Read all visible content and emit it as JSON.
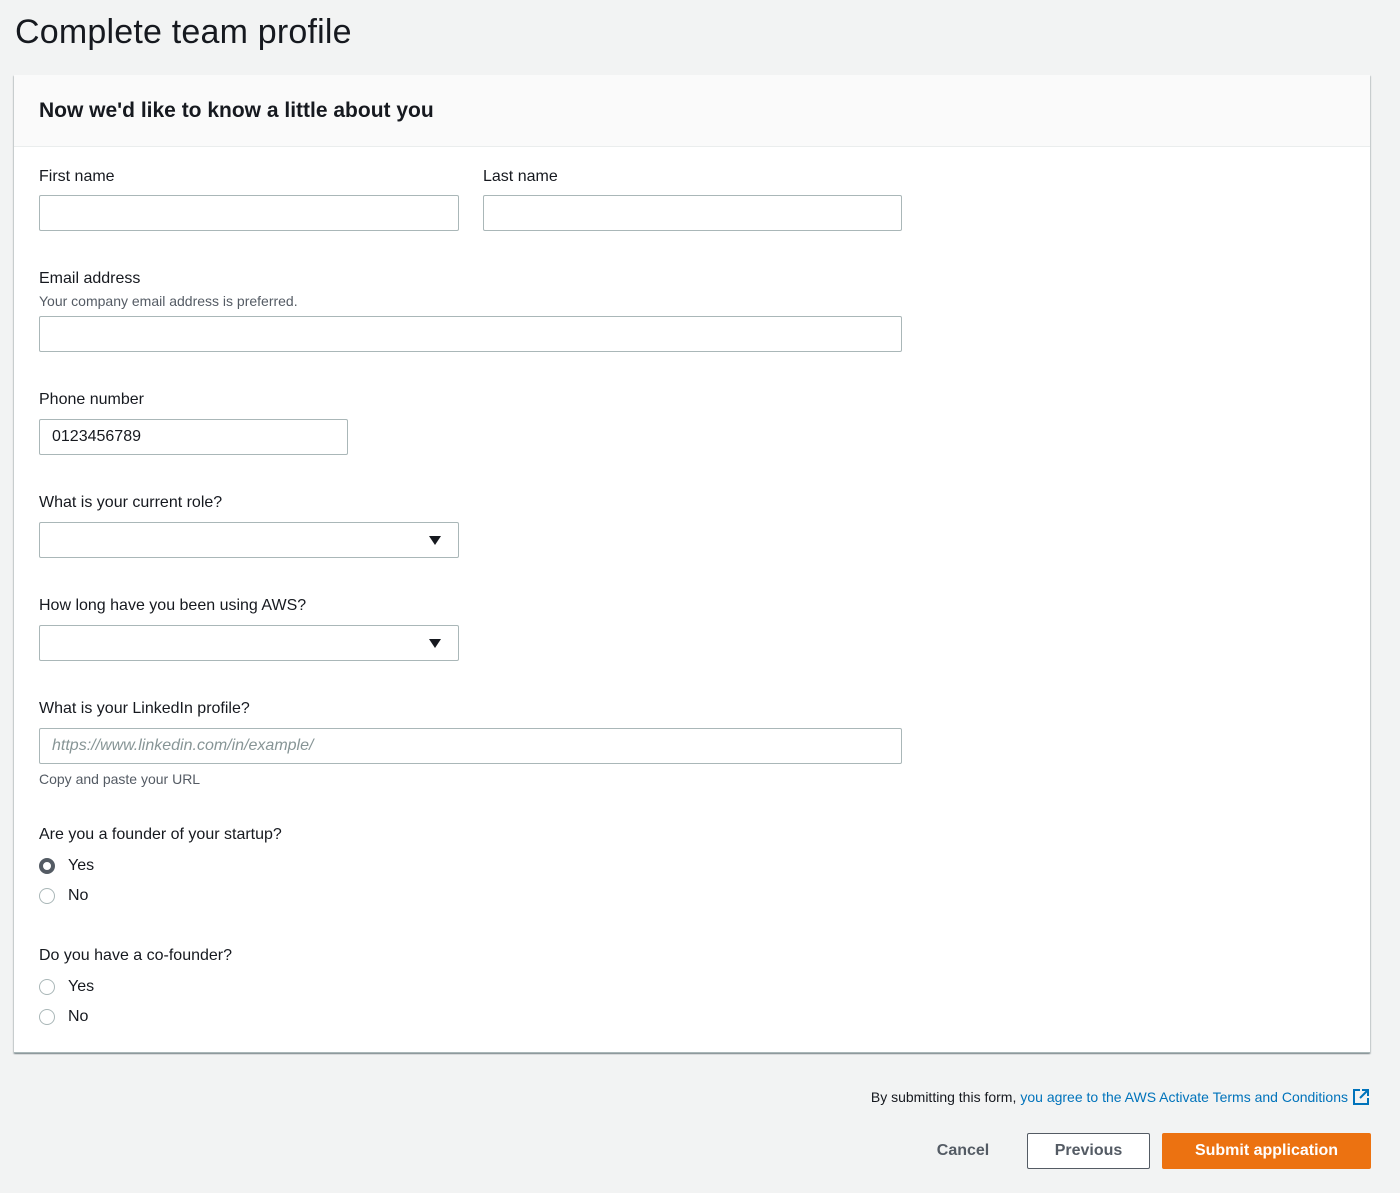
{
  "page": {
    "title": "Complete team profile"
  },
  "panel": {
    "heading": "Now we'd like to know a little about you"
  },
  "fields": {
    "first_name": {
      "label": "First name",
      "value": ""
    },
    "last_name": {
      "label": "Last name",
      "value": ""
    },
    "email": {
      "label": "Email address",
      "description": "Your company email address is preferred.",
      "value": ""
    },
    "phone": {
      "label": "Phone number",
      "value": "0123456789"
    },
    "role": {
      "label": "What is your current role?",
      "selected": ""
    },
    "aws_duration": {
      "label": "How long have you been using AWS?",
      "selected": ""
    },
    "linkedin": {
      "label": "What is your LinkedIn profile?",
      "placeholder": "https://www.linkedin.com/in/example/",
      "hint": "Copy and paste your URL",
      "value": ""
    },
    "founder": {
      "label": "Are you a founder of your startup?",
      "options": [
        "Yes",
        "No"
      ],
      "selected": "Yes"
    },
    "cofounder": {
      "label": "Do you have a co-founder?",
      "options": [
        "Yes",
        "No"
      ],
      "selected": ""
    }
  },
  "footer": {
    "terms_prefix": "By submitting this form,",
    "terms_link": "you agree to the AWS Activate Terms and Conditions",
    "external_icon": "external-link-icon",
    "cancel_label": "Cancel",
    "previous_label": "Previous",
    "submit_label": "Submit application"
  },
  "colors": {
    "primary": "#ec7211",
    "link": "#0073bb",
    "background": "#f2f3f3"
  }
}
